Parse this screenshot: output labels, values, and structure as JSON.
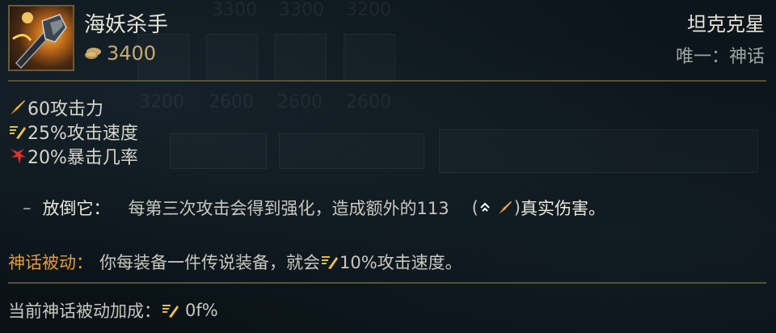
{
  "item": {
    "name": "海妖杀手",
    "price": "3400",
    "icon": "kraken-slayer-portrait",
    "category": "坦克克星",
    "unique": "唯一：神话"
  },
  "stats": [
    {
      "icon": "attack-damage-icon",
      "text": "60攻击力"
    },
    {
      "icon": "attack-speed-icon",
      "text": "25%攻击速度"
    },
    {
      "icon": "crit-chance-icon",
      "text": "20%暴击几率"
    }
  ],
  "passive": {
    "dash": "–",
    "name": "放倒它：",
    "desc": "每第三次攻击会得到强化，造成额外的113",
    "paren_open": "(",
    "paren_close": ")",
    "damage_type": "真实伤害。"
  },
  "mythic": {
    "label": "神话被动：",
    "text_before": "你每装备一件传说装备，就会",
    "value": "10%攻击速度。"
  },
  "bonus": {
    "label": "当前神话被动加成：",
    "value": "0f%"
  },
  "colors": {
    "background": "#0b141a",
    "gold_divider": "#5b5134",
    "price_gold": "#c8aa6e",
    "mythic_orange": "#e39b3a"
  }
}
